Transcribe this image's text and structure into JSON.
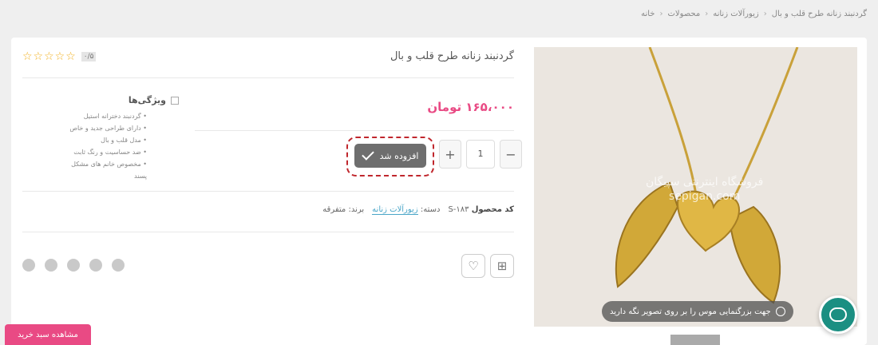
{
  "breadcrumb": [
    "خانه",
    "محصولات",
    "زیورآلات زنانه",
    "گردنبند زنانه طرح قلب و بال"
  ],
  "product": {
    "title": "گردنبند زنانه طرح قلب و بال",
    "price": "۱۶۵،۰۰۰ تومان",
    "rating_badge": "۰/۵",
    "stars": "☆☆☆☆☆",
    "quantity": "1",
    "sku_label": "کد محصول",
    "sku": "S-۱۸۳",
    "category_label": "دسته:",
    "category": "زیورآلات زنانه",
    "brand_label": "برند:",
    "brand": "متفرقه"
  },
  "added_button": {
    "label": "افزوده شد"
  },
  "features": {
    "title": "ویژگی‌ها",
    "items": [
      "گردنبند دخترانه استیل",
      "دارای طراحی جدید و خاص",
      "مدل قلب و بال",
      "ضد حساسیت و رنگ ثابت",
      "مخصوص خانم های مشکل پسند"
    ]
  },
  "image": {
    "watermark_line1": "فروشگاه اینترنتی سپیگان",
    "watermark_line2": "sepigan.com",
    "zoom_hint": "جهت بزرگنمایی موس را بر روی تصویر نگه دارید"
  },
  "footer": {
    "view_cart": "مشاهده سبد خرید"
  },
  "colors": {
    "accent": "#e94a84",
    "outline": "#c0272d",
    "chat": "#1b8f82"
  }
}
